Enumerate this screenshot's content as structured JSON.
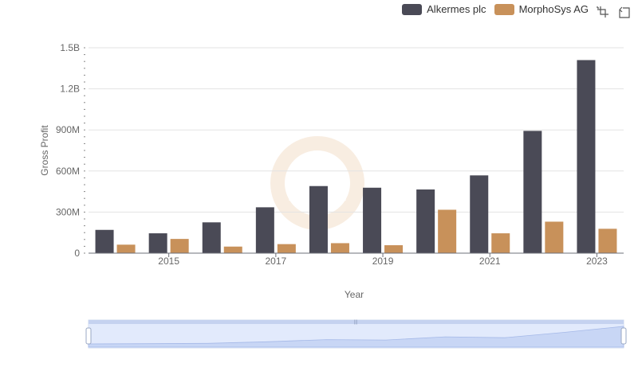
{
  "legend": [
    {
      "name": "Alkermes plc",
      "color": "#4a4a56"
    },
    {
      "name": "MorphoSys AG",
      "color": "#c8915a"
    }
  ],
  "toolbox": {
    "zoom_icon": "zoom-select-icon",
    "restore_icon": "zoom-reset-icon"
  },
  "chart_data": {
    "type": "bar",
    "x": [
      2014,
      2015,
      2016,
      2017,
      2018,
      2019,
      2020,
      2021,
      2022,
      2023
    ],
    "x_tick_labels": [
      "2015",
      "2017",
      "2019",
      "2021",
      "2023"
    ],
    "series": [
      {
        "name": "Alkermes plc",
        "color": "#4a4a56",
        "values": [
          170000000,
          145000000,
          225000000,
          335000000,
          490000000,
          478000000,
          465000000,
          568000000,
          893000000,
          1410000000
        ]
      },
      {
        "name": "MorphoSys AG",
        "color": "#c8915a",
        "values": [
          62000000,
          104000000,
          48000000,
          66000000,
          73000000,
          58000000,
          317000000,
          145000000,
          230000000,
          178000000
        ]
      }
    ],
    "ylim": [
      0,
      1500000000
    ],
    "y_ticks": [
      0,
      300000000,
      600000000,
      900000000,
      1200000000,
      1500000000
    ],
    "y_tick_labels": [
      "0",
      "300M",
      "600M",
      "900M",
      "1.2B",
      "1.5B"
    ],
    "xlabel": "Year",
    "ylabel": "Gross Profit",
    "grid": true,
    "legend_position": "top-right"
  }
}
